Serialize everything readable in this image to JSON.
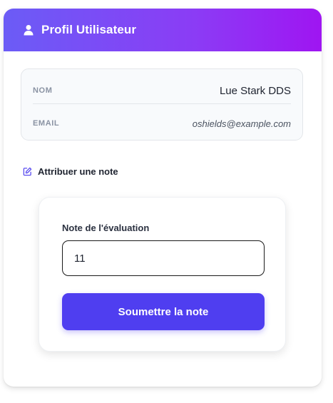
{
  "header": {
    "title": "Profil Utilisateur",
    "icon": "user-icon"
  },
  "profile": {
    "name_label": "NOM",
    "name_value": "Lue Stark DDS",
    "email_label": "EMAIL",
    "email_value": "oshields@example.com"
  },
  "rating_section": {
    "title": "Attribuer une note",
    "icon": "edit-icon"
  },
  "rating_form": {
    "label": "Note de l'évaluation",
    "value": "11",
    "submit_label": "Soumettre la note"
  },
  "colors": {
    "header_gradient_start": "#6b5cf6",
    "header_gradient_end": "#9f15f2",
    "button": "#4f3ef0",
    "edit_icon": "#5b4ef0"
  }
}
